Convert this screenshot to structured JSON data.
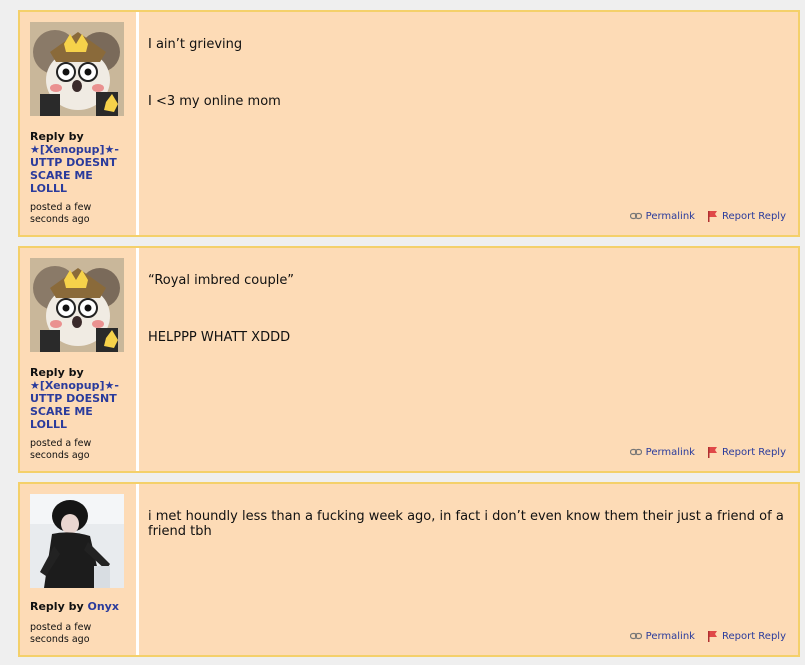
{
  "posts": [
    {
      "author": "★[Xenopup]★- UTTP DOESNT SCARE ME LOLLL",
      "reply_label": "Reply by",
      "posted": "posted a few seconds ago",
      "lines": [
        "I ain’t grieving",
        "I <3 my online mom"
      ],
      "permalink": "Permalink",
      "report": "Report Reply"
    },
    {
      "author": "★[Xenopup]★- UTTP DOESNT SCARE ME LOLLL",
      "reply_label": "Reply by",
      "posted": "posted a few seconds ago",
      "lines": [
        "“Royal imbred couple”",
        "HELPPP WHATT XDDD"
      ],
      "permalink": "Permalink",
      "report": "Report Reply"
    },
    {
      "author": "Onyx",
      "reply_label": "Reply by",
      "posted": "posted a few seconds ago",
      "lines": [
        "i met houndly less than a fucking week ago, in fact i don’t even know them their just a friend of a friend tbh"
      ],
      "permalink": "Permalink",
      "report": "Report Reply"
    }
  ],
  "colors": {
    "post_bg": "#fddbb6",
    "border": "#f4d06a",
    "link": "#2a3b9c",
    "page_bg": "#efefef"
  }
}
